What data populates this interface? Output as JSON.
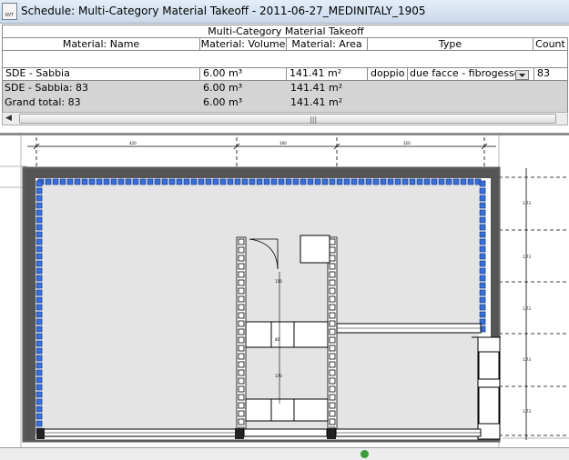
{
  "window": {
    "title": "Schedule: Multi-Category Material Takeoff - 2011-06-27_MEDINITALY_1905",
    "app_icon_text": "RVT"
  },
  "schedule": {
    "heading": "Multi-Category Material Takeoff",
    "columns": [
      "Material: Name",
      "Material: Volume",
      "Material: Area",
      "Type",
      "Count"
    ],
    "row": {
      "name": "SDE - Sabbia",
      "volume": "6.00 m³",
      "area": "141.41 m²",
      "type_part1": "doppio -",
      "type_part2": "due facce - fibrogesso e",
      "count": "83"
    },
    "subtotal": {
      "label": "SDE - Sabbia: 83",
      "volume": "6.00 m³",
      "area": "141.41 m²"
    },
    "grand_total": {
      "label": "Grand total: 83",
      "volume": "6.00 m³",
      "area": "141.41 m²"
    }
  },
  "plan": {
    "wall_fill_color": "#3a6fd8",
    "wall_color": "#6b6b6b"
  }
}
